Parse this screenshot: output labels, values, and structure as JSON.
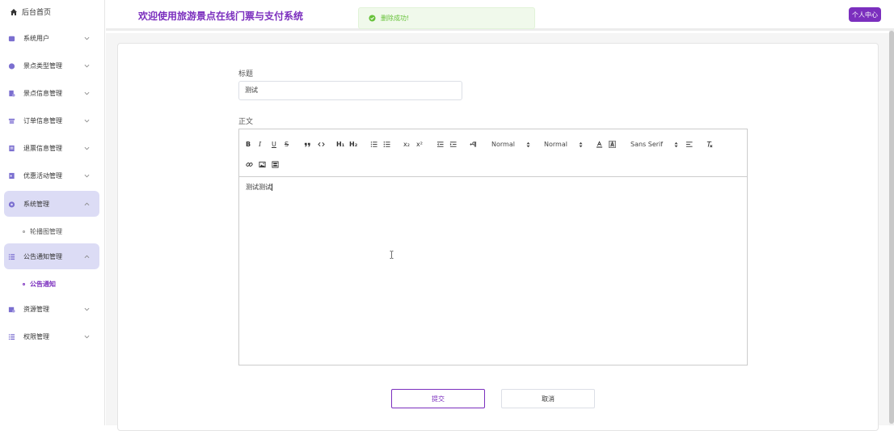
{
  "sidebar": {
    "home_label": "后台首页",
    "items": [
      {
        "label": "系统用户"
      },
      {
        "label": "景点类型管理"
      },
      {
        "label": "景点信息管理"
      },
      {
        "label": "订单信息管理"
      },
      {
        "label": "退票信息管理"
      },
      {
        "label": "优惠活动管理"
      },
      {
        "label": "系统管理"
      },
      {
        "label": "公告通知管理"
      },
      {
        "label": "资源管理"
      },
      {
        "label": "权限管理"
      }
    ],
    "sub_items": {
      "system": "轮播图管理",
      "notice": "公告通知"
    }
  },
  "header": {
    "site_title": "欢迎使用旅游景点在线门票与支付系统",
    "toast_message": "删除成功!",
    "user_center_label": "个人中心"
  },
  "form": {
    "title_label": "标题",
    "title_value": "测试",
    "body_label": "正文",
    "body_value": "测试测试",
    "toolbar": {
      "bold": "B",
      "italic": "I",
      "underline": "U",
      "strike": "S",
      "h1": "H₁",
      "h2": "H₂",
      "sub": "x₂",
      "sup": "x²",
      "size_select": "Normal",
      "header_select": "Normal",
      "font_select": "Sans Serif"
    },
    "submit_label": "提交",
    "cancel_label": "取消"
  },
  "colors": {
    "accent": "#7b2fbe",
    "active_menu_bg": "#dcdcf5",
    "success": "#67c23a"
  }
}
